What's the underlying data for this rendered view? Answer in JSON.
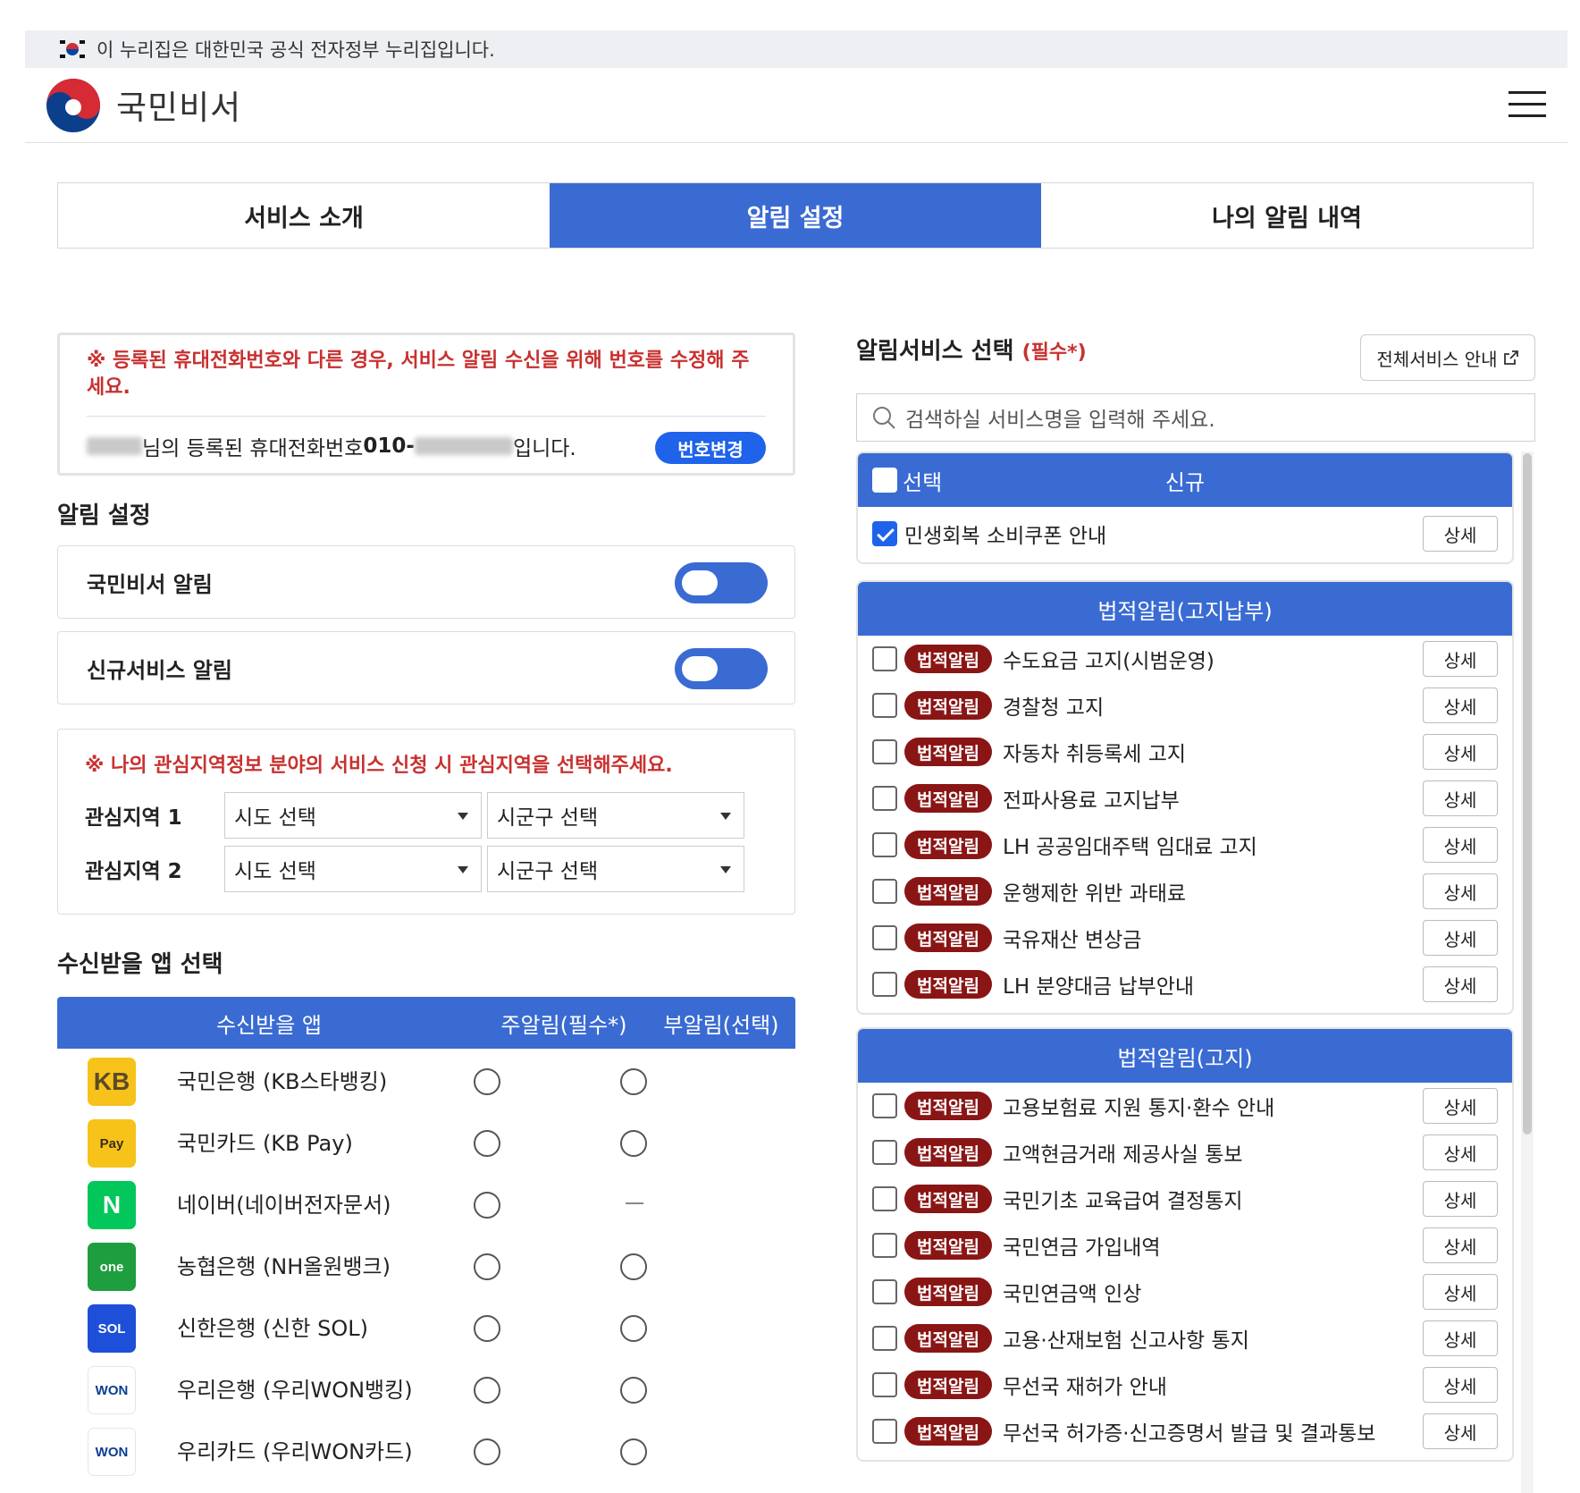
{
  "banner": {
    "text": "이 누리집은 대한민국 공식 전자정부 누리집입니다."
  },
  "header": {
    "logo_text": "국민비서"
  },
  "tabs": [
    {
      "label": "서비스 소개",
      "active": false
    },
    {
      "label": "알림 설정",
      "active": true
    },
    {
      "label": "나의 알림 내역",
      "active": false
    }
  ],
  "notice": {
    "warning": "※ 등록된 휴대전화번호와 다른 경우, 서비스 알림 수신을 위해 번호를 수정해 주세요.",
    "phone_prefix": "님의 등록된 휴대전화번호 ",
    "phone_number": "010-",
    "phone_suffix": "입니다.",
    "change_button": "번호변경"
  },
  "alarm_settings": {
    "title": "알림 설정",
    "items": [
      {
        "label": "국민비서 알림",
        "on": true
      },
      {
        "label": "신규서비스 알림",
        "on": true
      }
    ]
  },
  "region": {
    "note": "※ 나의 관심지역정보 분야의 서비스 신청 시 관심지역을 선택해주세요.",
    "rows": [
      {
        "label": "관심지역 1",
        "sido": "시도 선택",
        "sigungu": "시군구 선택"
      },
      {
        "label": "관심지역 2",
        "sido": "시도 선택",
        "sigungu": "시군구 선택"
      }
    ]
  },
  "app_select": {
    "title": "수신받을 앱 선택",
    "headers": {
      "app": "수신받을 앱",
      "main": "주알림(필수*)",
      "sub": "부알림(선택)"
    },
    "apps": [
      {
        "name": "국민은행 (KB스타뱅킹)",
        "icon": "kb-star-banking-icon",
        "icon_text": "KB",
        "bg": "#f7c21a",
        "fg": "#5a4a2a",
        "sub": true
      },
      {
        "name": "국민카드 (KB Pay)",
        "icon": "kb-pay-icon",
        "icon_text": "Pay",
        "bg": "#f7c21a",
        "fg": "#3a2e16",
        "sub": true
      },
      {
        "name": "네이버(네이버전자문서)",
        "icon": "naver-icon",
        "icon_text": "N",
        "bg": "#03c75a",
        "fg": "#ffffff",
        "sub": false
      },
      {
        "name": "농협은행 (NH올원뱅크)",
        "icon": "nh-allone-icon",
        "icon_text": "one",
        "bg": "#1e9e3e",
        "fg": "#ffffff",
        "sub": true
      },
      {
        "name": "신한은행 (신한 SOL)",
        "icon": "shinhan-sol-icon",
        "icon_text": "SOL",
        "bg": "#1d4fd8",
        "fg": "#ffffff",
        "sub": true
      },
      {
        "name": "우리은행 (우리WON뱅킹)",
        "icon": "woori-won-banking-icon",
        "icon_text": "WON",
        "bg": "#ffffff",
        "fg": "#0a3d91",
        "sub": true
      },
      {
        "name": "우리카드 (우리WON카드)",
        "icon": "woori-won-card-icon",
        "icon_text": "WON",
        "bg": "#ffffff",
        "fg": "#0a3d91",
        "sub": true
      }
    ]
  },
  "service_select": {
    "title": "알림서비스 선택",
    "required": "(필수*)",
    "all_button": "전체서비스 안내",
    "search_placeholder": "검색하실 서비스명을 입력해 주세요.",
    "detail_label": "상세",
    "badge_label": "법적알림",
    "new_group": {
      "select_label": "선택",
      "title": "신규",
      "items": [
        {
          "name": "민생회복 소비쿠폰 안내",
          "checked": true
        }
      ]
    },
    "groups": [
      {
        "title": "법적알림(고지납부)",
        "items": [
          "수도요금 고지(시범운영)",
          "경찰청 고지",
          "자동차 취등록세 고지",
          "전파사용료 고지납부",
          "LH 공공임대주택 임대료 고지",
          "운행제한 위반 과태료",
          "국유재산 변상금",
          "LH 분양대금 납부안내"
        ]
      },
      {
        "title": "법적알림(고지)",
        "items": [
          "고용보험료 지원 통지·환수 안내",
          "고액현금거래 제공사실 통보",
          "국민기초 교육급여 결정통지",
          "국민연금 가입내역",
          "국민연금액 인상",
          "고용·산재보험 신고사항 통지",
          "무선국 재허가 안내",
          "무선국 허가증·신고증명서 발급 및 결과통보"
        ]
      }
    ]
  }
}
